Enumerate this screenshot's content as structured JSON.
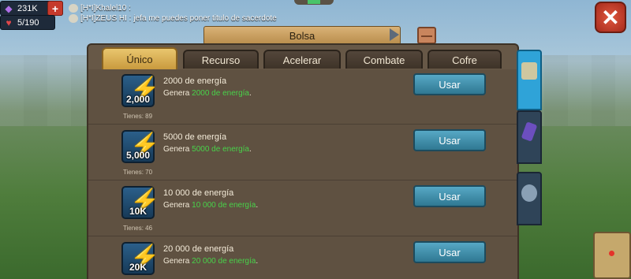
{
  "resources": {
    "gems": "231K",
    "health": "5/190"
  },
  "chat": [
    {
      "name": "[H*I]Khalel10 :",
      "text": ""
    },
    {
      "name": "[H*I]ZEUS HI :",
      "text": "jefa me puedes poner titulo de sacerdote"
    }
  ],
  "header": {
    "title": "Bolsa"
  },
  "tabs": [
    {
      "label": "Único",
      "active": true
    },
    {
      "label": "Recurso",
      "active": false
    },
    {
      "label": "Acelerar",
      "active": false
    },
    {
      "label": "Combate",
      "active": false
    },
    {
      "label": "Cofre",
      "active": false
    }
  ],
  "items": [
    {
      "amount": "2,000",
      "title": "2000 de energía",
      "desc_prefix": "Genera",
      "desc_value": "2000 de energía",
      "desc_suffix": ".",
      "have": "Tienes: 89",
      "button": "Usar"
    },
    {
      "amount": "5,000",
      "title": "5000 de energía",
      "desc_prefix": "Genera",
      "desc_value": "5000 de energía",
      "desc_suffix": ".",
      "have": "Tienes: 70",
      "button": "Usar"
    },
    {
      "amount": "10K",
      "title": "10 000 de energía",
      "desc_prefix": "Genera",
      "desc_value": "10 000 de energía",
      "desc_suffix": ".",
      "have": "Tienes: 46",
      "button": "Usar"
    },
    {
      "amount": "20K",
      "title": "20 000 de energía",
      "desc_prefix": "Genera",
      "desc_value": "20 000 de energía",
      "desc_suffix": ".",
      "have": "",
      "button": "Usar"
    }
  ],
  "icons": {
    "gem": "gem-icon",
    "health": "heart-icon",
    "plus": "plus-icon",
    "close": "close-icon",
    "chest": "chest-icon",
    "energy": "lightning-icon",
    "side_tabs": [
      "map-scroll-icon",
      "crystal-icon",
      "shield-icon"
    ]
  },
  "colors": {
    "highlight": "#48d24a",
    "active_tab": "#e9c66e",
    "button": "#3f8ea9",
    "close": "#c53a2c"
  }
}
